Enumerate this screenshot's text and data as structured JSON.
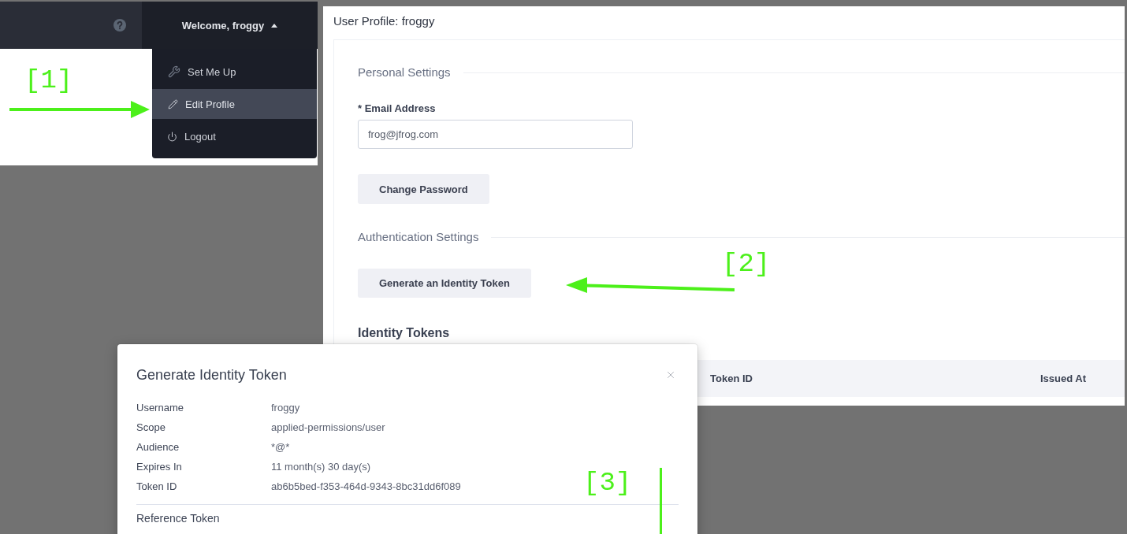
{
  "top_bar": {
    "user_menu": {
      "label": "Welcome, froggy",
      "expanded": true
    }
  },
  "user_menu_items": [
    {
      "label": "Set Me Up",
      "selected": false
    },
    {
      "label": "Edit Profile",
      "selected": true
    },
    {
      "label": "Logout",
      "selected": false
    }
  ],
  "profile": {
    "title": "User Profile: froggy",
    "personal_settings": {
      "heading": "Personal Settings",
      "email": {
        "label": "* Email Address",
        "value": "frog@jfrog.com"
      },
      "change_password_button": "Change Password"
    },
    "authentication_settings": {
      "heading": "Authentication Settings",
      "generate_button": "Generate an Identity Token"
    },
    "identity_tokens": {
      "heading": "Identity Tokens",
      "columns": [
        "Token ID",
        "Issued At"
      ]
    }
  },
  "dialog": {
    "title": "Generate Identity Token",
    "fields": [
      {
        "label": "Username",
        "value": "froggy"
      },
      {
        "label": "Scope",
        "value": "applied-permissions/user"
      },
      {
        "label": "Audience",
        "value": "*@*"
      },
      {
        "label": "Expires In",
        "value": "11 month(s) 30 day(s)"
      },
      {
        "label": "Token ID",
        "value": "ab6b5bed-f353-464d-9343-8bc31dd6f089"
      }
    ],
    "reference_token_label": "Reference Token"
  },
  "annotations": [
    {
      "label": "[1]",
      "kind": "arrow_right"
    },
    {
      "label": "[2]",
      "kind": "arrow_left"
    },
    {
      "label": "[3]",
      "kind": "line"
    }
  ]
}
